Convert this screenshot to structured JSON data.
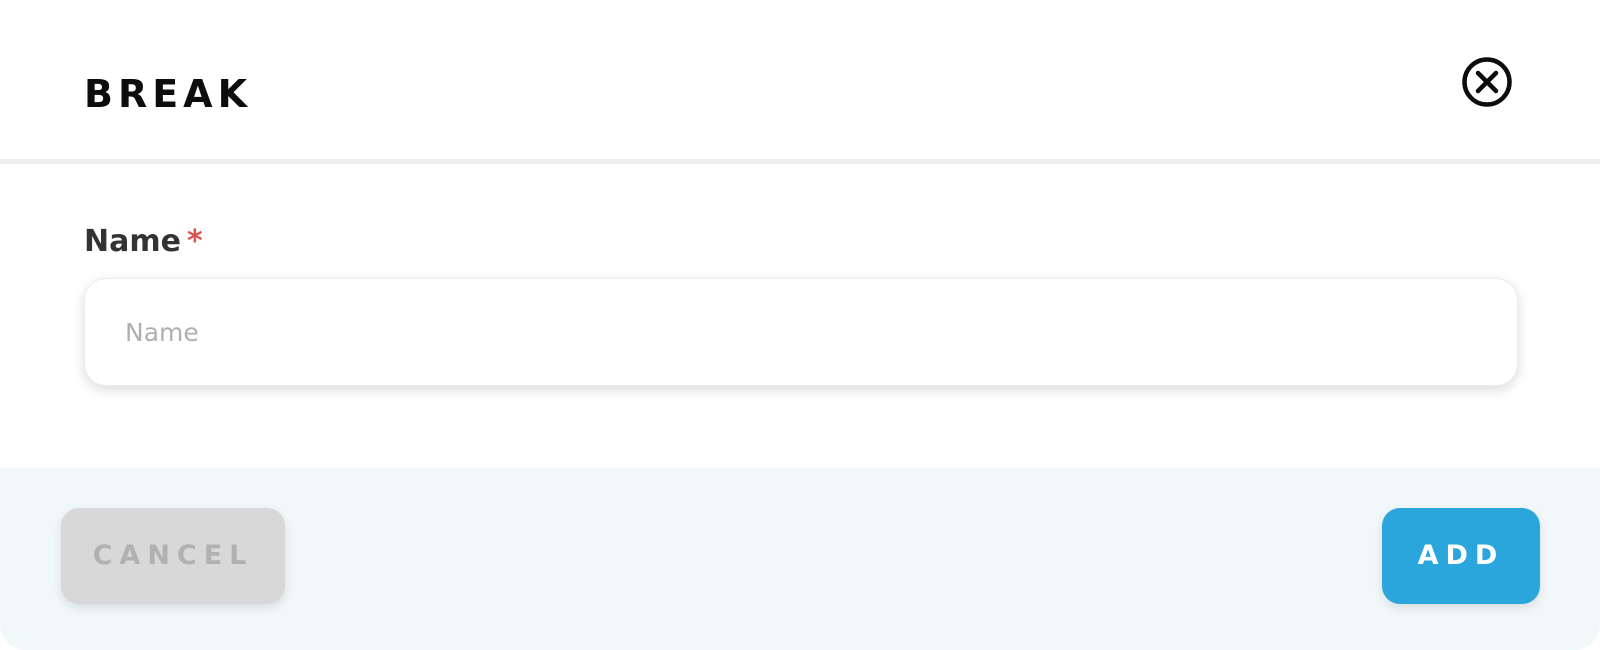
{
  "dialog": {
    "title": "BREAK"
  },
  "form": {
    "name_label": "Name",
    "required_marker": "*",
    "name_value": "",
    "name_placeholder": "Name"
  },
  "footer": {
    "cancel_label": "CANCEL",
    "add_label": "ADD"
  },
  "icons": {
    "close": "close-circle-icon"
  },
  "colors": {
    "primary": "#2ba6dd",
    "cancel_bg": "#d9d8d8",
    "cancel_text": "#b1b1b1",
    "footer_bg": "#f1f8fa",
    "required": "#d9534f"
  }
}
